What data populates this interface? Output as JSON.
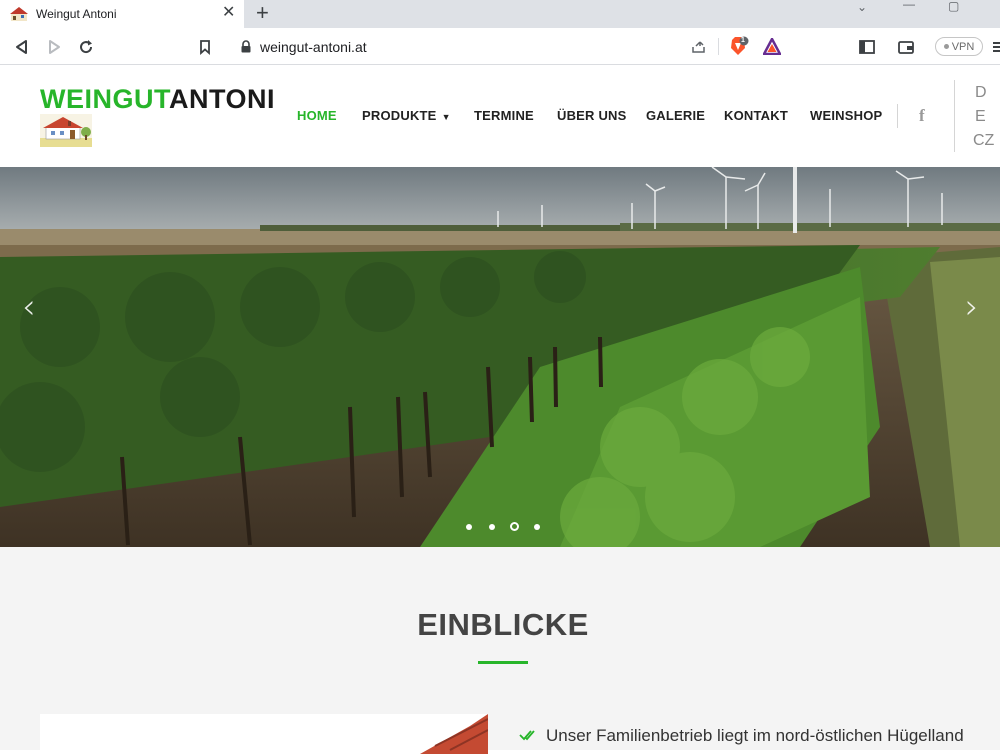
{
  "browser": {
    "tab_title": "Weingut Antoni",
    "url": "weingut-antoni.at",
    "vpn_label": "VPN",
    "shield_badge": "1",
    "icons": [
      "back-icon",
      "forward-icon",
      "reload-icon",
      "bookmark-icon",
      "lock-icon",
      "share-icon",
      "brave-shield-icon",
      "brave-rewards-icon",
      "sidebar-icon",
      "wallet-icon",
      "menu-icon"
    ]
  },
  "site": {
    "logo_part1": "WEINGUT",
    "logo_part2": "ANTONI",
    "nav": {
      "home": "HOME",
      "produkte": "PRODUKTE",
      "termine": "TERMINE",
      "ueber_uns": "ÜBER UNS",
      "galerie": "GALERIE",
      "kontakt": "KONTAKT",
      "weinshop": "WEINSHOP"
    },
    "facebook": "f",
    "languages": [
      "D",
      "E",
      "CZ"
    ],
    "accent_color": "#27b52a"
  },
  "slider": {
    "slide_count": 4,
    "active_slide": 3,
    "prev_arrow": "‹",
    "next_arrow": "›"
  },
  "section": {
    "title": "EINBLICKE",
    "text": "Unser Familienbetrieb liegt im nord-östlichen Hügelland"
  }
}
